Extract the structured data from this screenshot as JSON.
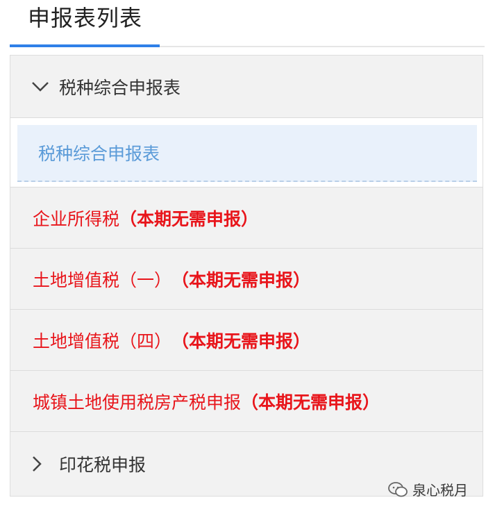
{
  "header": {
    "title": "申报表列表"
  },
  "panel": {
    "group1": {
      "label": "税种综合申报表",
      "expanded": true,
      "icon": "chevron-down-icon",
      "sub_items": [
        {
          "label": "税种综合申报表"
        }
      ]
    },
    "tax_rows": [
      {
        "name": "企业所得税",
        "note": "（本期无需申报）"
      },
      {
        "name": "土地增值税（一）",
        "note": "（本期无需申报）"
      },
      {
        "name": "土地增值税（四）",
        "note": "（本期无需申报）"
      },
      {
        "name": "城镇土地使用税房产税申报",
        "note": "（本期无需申报）"
      }
    ],
    "group2": {
      "label": "印花税申报",
      "expanded": false,
      "icon": "chevron-right-icon"
    }
  },
  "watermark": {
    "text": "泉心税月",
    "icon": "wechat-icon"
  },
  "colors": {
    "accent": "#2f80e8",
    "link": "#5b9bd8",
    "alert": "#e8151b",
    "panel_bg": "#f2f2f2"
  }
}
